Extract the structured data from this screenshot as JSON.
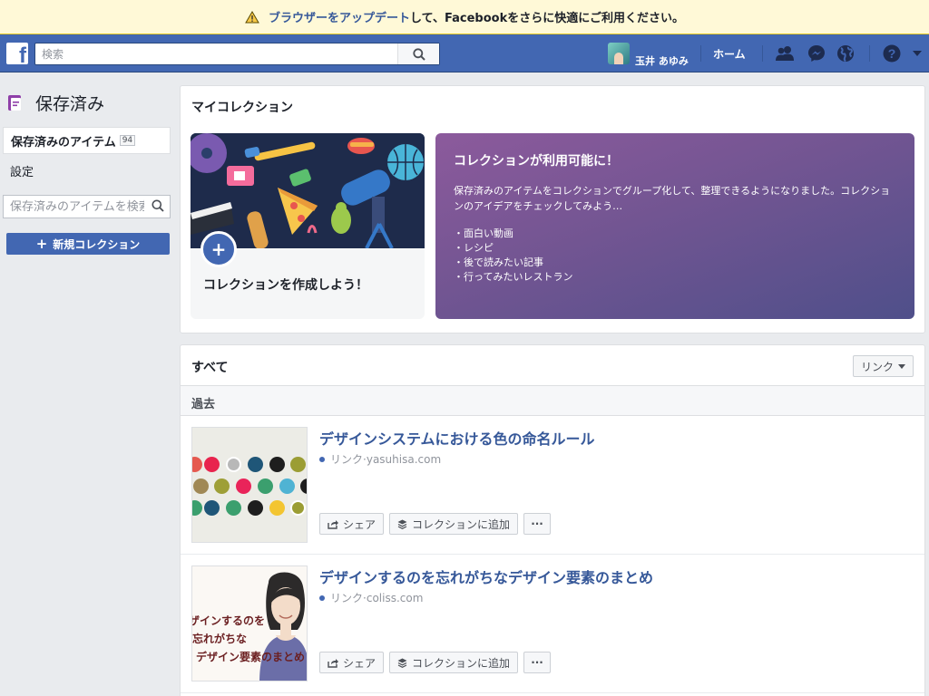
{
  "banner": {
    "link_text": "ブラウザーをアップデート",
    "rest_text": "して、Facebookをさらに快適にご利用ください。"
  },
  "topnav": {
    "logo": "f",
    "search_placeholder": "検索",
    "user_name": "玉井 あゆみ",
    "home_label": "ホーム",
    "icons": [
      "friends-icon",
      "messenger-icon",
      "globe-icon",
      "help-icon",
      "dropdown-caret-icon"
    ],
    "brand_color": "#4267b2"
  },
  "sidebar": {
    "title": "保存済み",
    "items": [
      {
        "label": "保存済みのアイテム",
        "count": "94"
      },
      {
        "label": "設定"
      }
    ],
    "search_placeholder": "保存済みのアイテムを検索",
    "new_collection_label": "新規コレクション"
  },
  "my_collections": {
    "header": "マイコレクション",
    "create_label": "コレクションを作成しよう！",
    "create_icon": "+",
    "promo": {
      "title": "コレクションが利用可能に！",
      "description": "保存済みのアイテムをコレクションでグループ化して、整理できるようになりました。コレクションのアイデアをチェックしてみよう…",
      "bullets": [
        "・面白い動画",
        "・レシピ",
        "・後で読みたい記事",
        "・行ってみたいレストラン"
      ]
    }
  },
  "all": {
    "header": "すべて",
    "filter_label": "リンク",
    "period": "過去",
    "items": [
      {
        "title": "デザインシステムにおける色の命名ルール",
        "type": "リンク",
        "source": "yasuhisa.com"
      },
      {
        "title": "デザインするのを忘れがちなデザイン要素のまとめ",
        "type": "リンク",
        "source": "coliss.com",
        "thumb_text": [
          "ザインするのを",
          "忘れがちな",
          "デザイン要素のまとめ"
        ]
      }
    ],
    "actions": {
      "share": "シェア",
      "add_to_collection": "コレクションに追加",
      "more": "···"
    },
    "meta_separator": " · "
  }
}
